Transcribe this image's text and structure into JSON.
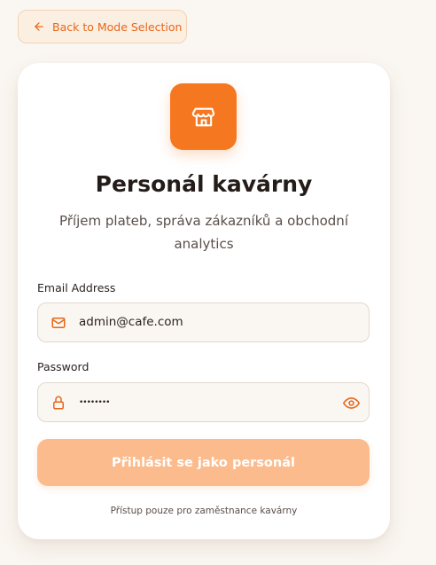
{
  "back_button": {
    "label": "Back to Mode Selection",
    "icon": "arrow-left-icon"
  },
  "card": {
    "logo_icon": "store-icon",
    "title": "Personál kavárny",
    "subtitle": "Příjem plateb, správa zákazníků a obchodní analytics",
    "email": {
      "label": "Email Address",
      "value": "admin@cafe.com",
      "icon": "mail-icon"
    },
    "password": {
      "label": "Password",
      "value": "••••••••",
      "icon": "lock-icon",
      "toggle_icon": "eye-icon"
    },
    "submit_label": "Přihlásit se jako personál",
    "footer_note": "Přístup pouze pro zaměstnance kavárny"
  },
  "colors": {
    "accent": "#f57820",
    "accent_light": "#fbbb8d",
    "background": "#faf6f1",
    "text": "#231c18"
  }
}
